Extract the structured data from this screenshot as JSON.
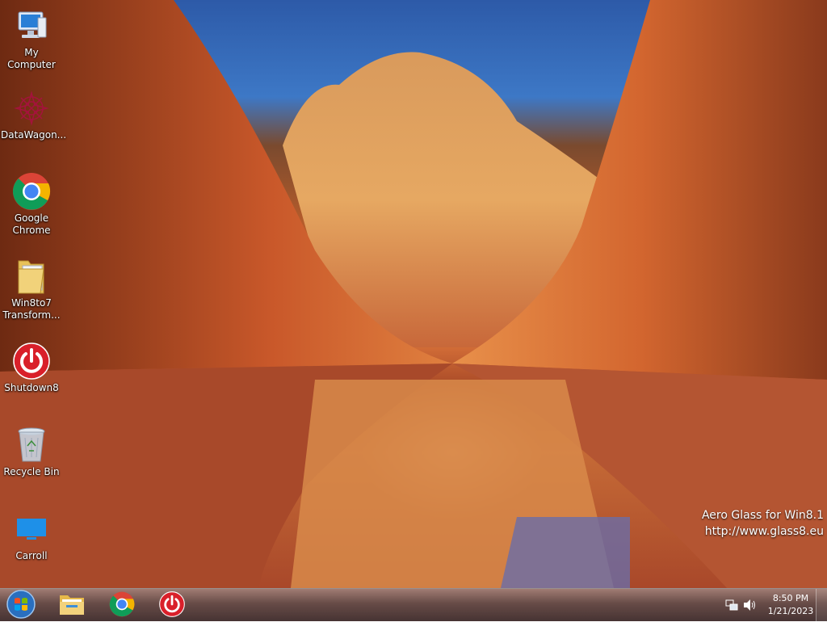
{
  "desktop": {
    "icons": [
      {
        "label": "My Computer",
        "icon": "computer-icon"
      },
      {
        "label": "DataWagon...",
        "icon": "datawagon-icon"
      },
      {
        "label": "Google Chrome",
        "icon": "chrome-icon"
      },
      {
        "label": "Win8to7 Transform...",
        "icon": "folder-icon"
      },
      {
        "label": "Shutdown8",
        "icon": "power-icon"
      },
      {
        "label": "Recycle Bin",
        "icon": "recycle-bin-icon"
      },
      {
        "label": "Carroll",
        "icon": "monitor-icon"
      }
    ],
    "watermark": {
      "line1": "Aero Glass for Win8.1",
      "line2": "http://www.glass8.eu"
    }
  },
  "taskbar": {
    "pinned": [
      {
        "icon": "start-orb-icon"
      },
      {
        "icon": "file-explorer-icon"
      },
      {
        "icon": "chrome-icon"
      },
      {
        "icon": "power-icon"
      }
    ],
    "tray": {
      "icons": [
        "network-icon",
        "volume-icon"
      ],
      "time": "8:50 PM",
      "date": "1/21/2023"
    }
  },
  "colors": {
    "sky": "#2d5aa8",
    "rock": "#c4602a",
    "taskbar": "#5a3c37"
  }
}
